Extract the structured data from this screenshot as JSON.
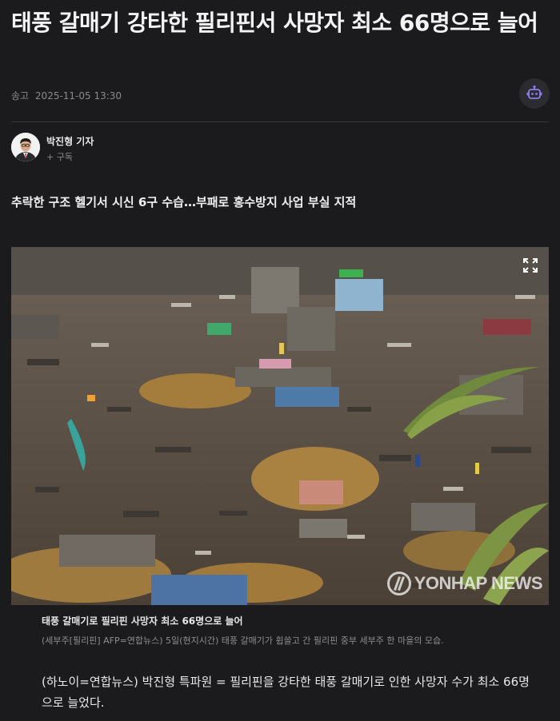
{
  "article": {
    "headline": "태풍 갈매기 강타한 필리핀서 사망자 최소 66명으로 늘어",
    "meta": {
      "label": "송고",
      "datetime": "2025-11-05 13:30"
    },
    "robot_button": {
      "icon": "robot-icon"
    },
    "author": {
      "name": "박진형 기자",
      "subscribe_label": "+ 구독"
    },
    "subheadline": "추락한 구조 헬기서 시신 6구 수습…부패로 홍수방지 사업 부실 지적",
    "photo": {
      "expand_icon": "expand-icon",
      "watermark": "YONHAP NEWS",
      "caption_title": "태풍 갈매기로 필리핀 사망자 최소 66명으로 늘어",
      "caption_body": "(세부주[필리핀] AFP=연합뉴스) 5일(현지시간) 태풍 갈매기가 휩쓸고 간 필리핀 중부 세부주 한 마을의 모습."
    },
    "body": "(하노이=연합뉴스) 박진형 특파원 = 필리핀을 강타한 태풍 갈매기로 인한 사망자 수가 최소 66명으로 늘었다."
  },
  "colors": {
    "background": "#1b1b1d",
    "text": "#ececec",
    "muted": "#8a8a8e",
    "divider": "#38383c"
  }
}
